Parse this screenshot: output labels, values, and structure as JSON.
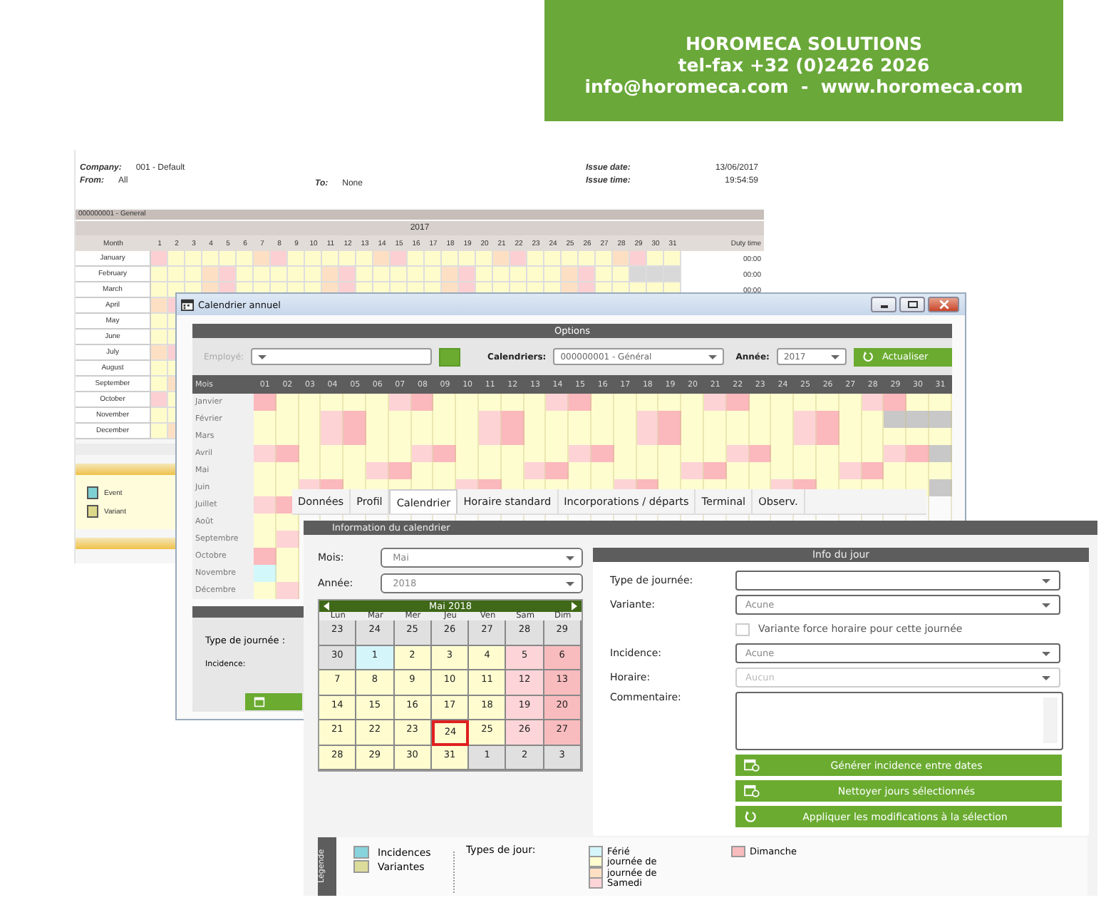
{
  "banner": {
    "lines": [
      "HOROMECA SOLUTIONS",
      "tel-fax +32 (0)2426 2026",
      "info@horomeca.com  -  www.horomeca.com"
    ]
  },
  "report": {
    "fields": [
      {
        "label": "Company:",
        "value": "001 - Default"
      },
      {
        "label": "From:",
        "value": "All"
      },
      {
        "label": "To:",
        "value": "None"
      },
      {
        "label": "Issue date:",
        "value": "13/06/2017"
      },
      {
        "label": "Issue time:",
        "value": "19:54:59"
      }
    ],
    "calendar_name": "000000001 - General",
    "year": "2017",
    "month_header": "Month",
    "total_header": "Duty time",
    "day_headers": [
      "1",
      "2",
      "3",
      "4",
      "5",
      "6",
      "7",
      "8",
      "9",
      "10",
      "11",
      "12",
      "13",
      "14",
      "15",
      "16",
      "17",
      "18",
      "19",
      "20",
      "21",
      "22",
      "23",
      "24",
      "25",
      "26",
      "27",
      "28",
      "29",
      "30",
      "31"
    ],
    "rows": [
      {
        "month": "January",
        "total": "00:00",
        "days": [
          {
            "kind": "sun"
          },
          {
            "kind": "work"
          },
          {
            "kind": "work"
          },
          {
            "kind": "work"
          },
          {
            "kind": "work"
          },
          {
            "kind": "work"
          },
          {
            "kind": "sat"
          },
          {
            "kind": "sun"
          },
          {
            "kind": "work"
          },
          {
            "kind": "work"
          },
          {
            "kind": "work"
          },
          {
            "kind": "work"
          },
          {
            "kind": "work"
          },
          {
            "kind": "sat"
          },
          {
            "kind": "sun"
          },
          {
            "kind": "work"
          },
          {
            "kind": "work"
          },
          {
            "kind": "work"
          },
          {
            "kind": "work"
          },
          {
            "kind": "work"
          },
          {
            "kind": "sat"
          },
          {
            "kind": "sun"
          },
          {
            "kind": "work"
          },
          {
            "kind": "work"
          },
          {
            "kind": "work"
          },
          {
            "kind": "work"
          },
          {
            "kind": "work"
          },
          {
            "kind": "sat"
          },
          {
            "kind": "sun"
          },
          {
            "kind": "work"
          },
          {
            "kind": "work"
          }
        ]
      },
      {
        "month": "February",
        "total": "00:00",
        "days": [
          {
            "kind": "work"
          },
          {
            "kind": "work"
          },
          {
            "kind": "work"
          },
          {
            "kind": "sat"
          },
          {
            "kind": "sun"
          },
          {
            "kind": "work"
          },
          {
            "kind": "work"
          },
          {
            "kind": "work"
          },
          {
            "kind": "work"
          },
          {
            "kind": "work"
          },
          {
            "kind": "sat"
          },
          {
            "kind": "sun"
          },
          {
            "kind": "work"
          },
          {
            "kind": "work"
          },
          {
            "kind": "work"
          },
          {
            "kind": "work"
          },
          {
            "kind": "work"
          },
          {
            "kind": "sat"
          },
          {
            "kind": "sun"
          },
          {
            "kind": "work"
          },
          {
            "kind": "work"
          },
          {
            "kind": "work"
          },
          {
            "kind": "work"
          },
          {
            "kind": "work"
          },
          {
            "kind": "sat"
          },
          {
            "kind": "sun"
          },
          {
            "kind": "work"
          },
          {
            "kind": "work"
          },
          {
            "kind": "none"
          },
          {
            "kind": "none"
          },
          {
            "kind": "none"
          }
        ]
      },
      {
        "month": "March",
        "total": "00:00",
        "days": [
          {
            "kind": "work"
          },
          {
            "kind": "work"
          },
          {
            "kind": "work"
          },
          {
            "kind": "sat"
          },
          {
            "kind": "sun"
          },
          {
            "kind": "work"
          },
          {
            "kind": "work"
          },
          {
            "kind": "work"
          },
          {
            "kind": "work"
          },
          {
            "kind": "work"
          },
          {
            "kind": "sat"
          },
          {
            "kind": "sun"
          },
          {
            "kind": "work"
          },
          {
            "kind": "work"
          },
          {
            "kind": "work"
          },
          {
            "kind": "work"
          },
          {
            "kind": "work"
          },
          {
            "kind": "sat"
          },
          {
            "kind": "sun"
          },
          {
            "kind": "work"
          },
          {
            "kind": "work"
          },
          {
            "kind": "work"
          },
          {
            "kind": "work"
          },
          {
            "kind": "work"
          },
          {
            "kind": "sat"
          },
          {
            "kind": "sun"
          },
          {
            "kind": "work"
          },
          {
            "kind": "work"
          },
          {
            "kind": "work"
          },
          {
            "kind": "work"
          },
          {
            "kind": "work"
          }
        ]
      },
      {
        "month": "April",
        "days": [
          {
            "kind": "sat"
          },
          {
            "kind": "sun"
          }
        ]
      },
      {
        "month": "May",
        "days": [
          {
            "kind": "work"
          },
          {
            "kind": "work"
          }
        ]
      },
      {
        "month": "June",
        "days": [
          {
            "kind": "work"
          },
          {
            "kind": "work"
          }
        ]
      },
      {
        "month": "July",
        "days": [
          {
            "kind": "sat"
          },
          {
            "kind": "sun"
          }
        ]
      },
      {
        "month": "August",
        "days": [
          {
            "kind": "work"
          },
          {
            "kind": "work"
          }
        ]
      },
      {
        "month": "September",
        "days": [
          {
            "kind": "work"
          },
          {
            "kind": "sat"
          }
        ]
      },
      {
        "month": "October",
        "days": [
          {
            "kind": "sun"
          },
          {
            "kind": "work"
          }
        ]
      },
      {
        "month": "November",
        "days": [
          {
            "kind": "work"
          },
          {
            "kind": "work"
          }
        ]
      },
      {
        "month": "December",
        "days": [
          {
            "kind": "work"
          },
          {
            "kind": "sat"
          }
        ]
      }
    ],
    "legend": [
      {
        "label": "Event",
        "color": "#7fd0d4"
      },
      {
        "label": "Variant",
        "color": "#dcd98a"
      }
    ]
  },
  "annual_window": {
    "title": "Calendrier annuel",
    "options_title": "Options",
    "employee_label": "Employé:",
    "calendars_label": "Calendriers:",
    "calendars_value": "000000001 - Général",
    "year_label": "Année:",
    "year_value": "2017",
    "refresh_button": "Actualiser",
    "month_header": "Mois",
    "day_headers": [
      "01",
      "02",
      "03",
      "04",
      "05",
      "06",
      "07",
      "08",
      "09",
      "10",
      "11",
      "12",
      "13",
      "14",
      "15",
      "16",
      "17",
      "18",
      "19",
      "20",
      "21",
      "22",
      "23",
      "24",
      "25",
      "26",
      "27",
      "28",
      "29",
      "30",
      "31"
    ],
    "rows": [
      {
        "month": "Janvier",
        "days": [
          {
            "kind": "sun"
          },
          {
            "kind": "work"
          },
          {
            "kind": "work"
          },
          {
            "kind": "work"
          },
          {
            "kind": "work"
          },
          {
            "kind": "work"
          },
          {
            "kind": "sat"
          },
          {
            "kind": "sun"
          },
          {
            "kind": "work"
          },
          {
            "kind": "work"
          },
          {
            "kind": "work"
          },
          {
            "kind": "work"
          },
          {
            "kind": "work"
          },
          {
            "kind": "sat"
          },
          {
            "kind": "sun"
          },
          {
            "kind": "work"
          },
          {
            "kind": "work"
          },
          {
            "kind": "work"
          },
          {
            "kind": "work"
          },
          {
            "kind": "work"
          },
          {
            "kind": "sat"
          },
          {
            "kind": "sun"
          },
          {
            "kind": "work"
          },
          {
            "kind": "work"
          },
          {
            "kind": "work"
          },
          {
            "kind": "work"
          },
          {
            "kind": "work"
          },
          {
            "kind": "sat"
          },
          {
            "kind": "sun"
          },
          {
            "kind": "work"
          },
          {
            "kind": "work"
          }
        ]
      },
      {
        "month": "Février",
        "days": [
          {
            "kind": "work"
          },
          {
            "kind": "work"
          },
          {
            "kind": "work"
          },
          {
            "kind": "sat"
          },
          {
            "kind": "sun"
          },
          {
            "kind": "work"
          },
          {
            "kind": "work"
          },
          {
            "kind": "work"
          },
          {
            "kind": "work"
          },
          {
            "kind": "work"
          },
          {
            "kind": "sat"
          },
          {
            "kind": "sun"
          },
          {
            "kind": "work"
          },
          {
            "kind": "work"
          },
          {
            "kind": "work"
          },
          {
            "kind": "work"
          },
          {
            "kind": "work"
          },
          {
            "kind": "sat"
          },
          {
            "kind": "sun"
          },
          {
            "kind": "work"
          },
          {
            "kind": "work"
          },
          {
            "kind": "work"
          },
          {
            "kind": "work"
          },
          {
            "kind": "work"
          },
          {
            "kind": "sat"
          },
          {
            "kind": "sun"
          },
          {
            "kind": "work"
          },
          {
            "kind": "work"
          },
          {
            "kind": "none"
          },
          {
            "kind": "none"
          },
          {
            "kind": "none"
          }
        ]
      },
      {
        "month": "Mars",
        "days": [
          {
            "kind": "work"
          },
          {
            "kind": "work"
          },
          {
            "kind": "work"
          },
          {
            "kind": "sat"
          },
          {
            "kind": "sun"
          },
          {
            "kind": "work"
          },
          {
            "kind": "work"
          },
          {
            "kind": "work"
          },
          {
            "kind": "work"
          },
          {
            "kind": "work"
          },
          {
            "kind": "sat"
          },
          {
            "kind": "sun"
          },
          {
            "kind": "work"
          },
          {
            "kind": "work"
          },
          {
            "kind": "work"
          },
          {
            "kind": "work"
          },
          {
            "kind": "work"
          },
          {
            "kind": "sat"
          },
          {
            "kind": "sun"
          },
          {
            "kind": "work"
          },
          {
            "kind": "work"
          },
          {
            "kind": "work"
          },
          {
            "kind": "work"
          },
          {
            "kind": "work"
          },
          {
            "kind": "sat"
          },
          {
            "kind": "sun"
          },
          {
            "kind": "work"
          },
          {
            "kind": "work"
          },
          {
            "kind": "work"
          },
          {
            "kind": "work"
          },
          {
            "kind": "work"
          }
        ]
      },
      {
        "month": "Avril",
        "days": [
          {
            "kind": "sat"
          },
          {
            "kind": "sun"
          },
          {
            "kind": "work"
          },
          {
            "kind": "work"
          },
          {
            "kind": "work"
          },
          {
            "kind": "work"
          },
          {
            "kind": "work"
          },
          {
            "kind": "sat"
          },
          {
            "kind": "sun"
          },
          {
            "kind": "work"
          },
          {
            "kind": "work"
          },
          {
            "kind": "work"
          },
          {
            "kind": "work"
          },
          {
            "kind": "work"
          },
          {
            "kind": "sat"
          },
          {
            "kind": "sun"
          },
          {
            "kind": "work"
          },
          {
            "kind": "work"
          },
          {
            "kind": "work"
          },
          {
            "kind": "work"
          },
          {
            "kind": "work"
          },
          {
            "kind": "sat"
          },
          {
            "kind": "sun"
          },
          {
            "kind": "work"
          },
          {
            "kind": "work"
          },
          {
            "kind": "work"
          },
          {
            "kind": "work"
          },
          {
            "kind": "work"
          },
          {
            "kind": "sat"
          },
          {
            "kind": "sun"
          },
          {
            "kind": "none"
          }
        ]
      },
      {
        "month": "Mai",
        "days": [
          {
            "kind": "work"
          },
          {
            "kind": "work"
          },
          {
            "kind": "work"
          },
          {
            "kind": "work"
          },
          {
            "kind": "work"
          },
          {
            "kind": "sat"
          },
          {
            "kind": "sun"
          },
          {
            "kind": "work"
          },
          {
            "kind": "work"
          },
          {
            "kind": "work"
          },
          {
            "kind": "work"
          },
          {
            "kind": "work"
          },
          {
            "kind": "sat"
          },
          {
            "kind": "sun"
          },
          {
            "kind": "work"
          },
          {
            "kind": "work"
          },
          {
            "kind": "work"
          },
          {
            "kind": "work"
          },
          {
            "kind": "work"
          },
          {
            "kind": "sat"
          },
          {
            "kind": "sun"
          },
          {
            "kind": "work"
          },
          {
            "kind": "work"
          },
          {
            "kind": "work"
          },
          {
            "kind": "work"
          },
          {
            "kind": "work"
          },
          {
            "kind": "sat"
          },
          {
            "kind": "sun"
          },
          {
            "kind": "work"
          },
          {
            "kind": "work"
          },
          {
            "kind": "work"
          }
        ]
      },
      {
        "month": "Juin",
        "days": [
          {
            "kind": "work"
          },
          {
            "kind": "work"
          },
          {
            "kind": "sat"
          },
          {
            "kind": "sun"
          },
          {
            "kind": "work"
          },
          {
            "kind": "work"
          },
          {
            "kind": "work"
          },
          {
            "kind": "work"
          },
          {
            "kind": "work"
          },
          {
            "kind": "sat"
          },
          {
            "kind": "sun"
          },
          {
            "kind": "work"
          },
          {
            "kind": "work"
          },
          {
            "kind": "work"
          },
          {
            "kind": "work"
          },
          {
            "kind": "work"
          },
          {
            "kind": "sat"
          },
          {
            "kind": "sun"
          },
          {
            "kind": "work"
          },
          {
            "kind": "work"
          },
          {
            "kind": "work"
          },
          {
            "kind": "work"
          },
          {
            "kind": "work"
          },
          {
            "kind": "sat"
          },
          {
            "kind": "sun"
          },
          {
            "kind": "work"
          },
          {
            "kind": "work"
          },
          {
            "kind": "work"
          },
          {
            "kind": "work"
          },
          {
            "kind": "work"
          },
          {
            "kind": "none"
          }
        ]
      },
      {
        "month": "Juillet",
        "days": [
          {
            "kind": "sat"
          },
          {
            "kind": "sun"
          }
        ]
      },
      {
        "month": "Août",
        "days": [
          {
            "kind": "work"
          },
          {
            "kind": "work"
          }
        ]
      },
      {
        "month": "Septembre",
        "days": [
          {
            "kind": "work"
          },
          {
            "kind": "sat"
          }
        ]
      },
      {
        "month": "Octobre",
        "days": [
          {
            "kind": "sun"
          },
          {
            "kind": "work"
          }
        ]
      },
      {
        "month": "Novembre",
        "days": [
          {
            "kind": "hol"
          },
          {
            "kind": "work"
          }
        ]
      },
      {
        "month": "Décembre",
        "days": [
          {
            "kind": "work"
          },
          {
            "kind": "sat"
          }
        ]
      }
    ],
    "day_type_label": "Type de journée :",
    "incidence_label": "Incidence:"
  },
  "employee_window": {
    "tabs": [
      {
        "label": "Données",
        "selected": false
      },
      {
        "label": "Profil",
        "selected": false
      },
      {
        "label": "Calendrier",
        "selected": true
      },
      {
        "label": "Horaire standard",
        "selected": false
      },
      {
        "label": "Incorporations / départs",
        "selected": false
      },
      {
        "label": "Terminal",
        "selected": false
      },
      {
        "label": "Observ.",
        "selected": false
      }
    ],
    "section_title": "Information du calendrier",
    "month_label": "Mois:",
    "month_value": "Mai",
    "year_label": "Année:",
    "year_value": "2018",
    "calendar": {
      "title": "Mai 2018",
      "weekdays": [
        "Lun",
        "Mar",
        "Mer",
        "Jeu",
        "Ven",
        "Sam",
        "Dim"
      ],
      "days": [
        {
          "day": "23",
          "kind": "other",
          "selected": false
        },
        {
          "day": "24",
          "kind": "other",
          "selected": false
        },
        {
          "day": "25",
          "kind": "other",
          "selected": false
        },
        {
          "day": "26",
          "kind": "other",
          "selected": false
        },
        {
          "day": "27",
          "kind": "other",
          "selected": false
        },
        {
          "day": "28",
          "kind": "other",
          "selected": false
        },
        {
          "day": "29",
          "kind": "other",
          "selected": false
        },
        {
          "day": "30",
          "kind": "other",
          "selected": false
        },
        {
          "day": "1",
          "kind": "hol",
          "selected": false
        },
        {
          "day": "2",
          "kind": "work",
          "selected": false
        },
        {
          "day": "3",
          "kind": "work",
          "selected": false
        },
        {
          "day": "4",
          "kind": "work",
          "selected": false
        },
        {
          "day": "5",
          "kind": "sat",
          "selected": false
        },
        {
          "day": "6",
          "kind": "sun",
          "selected": false
        },
        {
          "day": "7",
          "kind": "work",
          "selected": false
        },
        {
          "day": "8",
          "kind": "work",
          "selected": false
        },
        {
          "day": "9",
          "kind": "work",
          "selected": false
        },
        {
          "day": "10",
          "kind": "work",
          "selected": false
        },
        {
          "day": "11",
          "kind": "work",
          "selected": false
        },
        {
          "day": "12",
          "kind": "sat",
          "selected": false
        },
        {
          "day": "13",
          "kind": "sun",
          "selected": false
        },
        {
          "day": "14",
          "kind": "work",
          "selected": false
        },
        {
          "day": "15",
          "kind": "work",
          "selected": false
        },
        {
          "day": "16",
          "kind": "work",
          "selected": false
        },
        {
          "day": "17",
          "kind": "work",
          "selected": false
        },
        {
          "day": "18",
          "kind": "work",
          "selected": false
        },
        {
          "day": "19",
          "kind": "sat",
          "selected": false
        },
        {
          "day": "20",
          "kind": "sun",
          "selected": false
        },
        {
          "day": "21",
          "kind": "work",
          "selected": false
        },
        {
          "day": "22",
          "kind": "work",
          "selected": false
        },
        {
          "day": "23",
          "kind": "work",
          "selected": false
        },
        {
          "day": "24",
          "kind": "work",
          "selected": true
        },
        {
          "day": "25",
          "kind": "work",
          "selected": false
        },
        {
          "day": "26",
          "kind": "sat",
          "selected": false
        },
        {
          "day": "27",
          "kind": "sun",
          "selected": false
        },
        {
          "day": "28",
          "kind": "work",
          "selected": false
        },
        {
          "day": "29",
          "kind": "work",
          "selected": false
        },
        {
          "day": "30",
          "kind": "work",
          "selected": false
        },
        {
          "day": "31",
          "kind": "work",
          "selected": false
        },
        {
          "day": "1",
          "kind": "other",
          "selected": false
        },
        {
          "day": "2",
          "kind": "other",
          "selected": false
        },
        {
          "day": "3",
          "kind": "other",
          "selected": false
        }
      ]
    },
    "day_info": {
      "title": "Info du jour",
      "fields": [
        {
          "label": "Type de journée:",
          "kind": "select",
          "disabled": false
        },
        {
          "label": "Variante:",
          "kind": "select",
          "value": "Acune",
          "disabled": false
        },
        {
          "label": "Variante force horaire pour cette journée",
          "kind": "checkbox",
          "checked": false,
          "disabled": false
        },
        {
          "label": "Incidence:",
          "kind": "select",
          "value": "Acune",
          "disabled": false
        },
        {
          "label": "Horaire:",
          "kind": "select",
          "value": "Aucun",
          "disabled": true
        },
        {
          "label": "Commentaire:",
          "kind": "textarea",
          "disabled": false
        }
      ],
      "buttons": [
        {
          "label": "Générer incidence entre dates",
          "kind": "calendar"
        },
        {
          "label": "Nettoyer jours sélectionnés",
          "kind": "calendar"
        },
        {
          "label": "Appliquer les modifications à la sélection",
          "kind": "apply"
        }
      ]
    },
    "legend_title": "Légende",
    "legend_items": [
      {
        "label": "Incidences",
        "color": "#88d4dc"
      },
      {
        "label": "Variantes",
        "color": "#dcdc9a"
      }
    ],
    "day_types_label": "Types de jour:",
    "day_types": [
      {
        "label": "Férié",
        "color": "#d4f6fb"
      },
      {
        "label": "journée de",
        "color": "#fffdd0"
      },
      {
        "label": "journée de",
        "color": "#fde0c4"
      },
      {
        "label": "Samedi",
        "color": "#fdd5d8"
      },
      {
        "label": "Dimanche",
        "color": "#f9bcbe"
      }
    ]
  }
}
